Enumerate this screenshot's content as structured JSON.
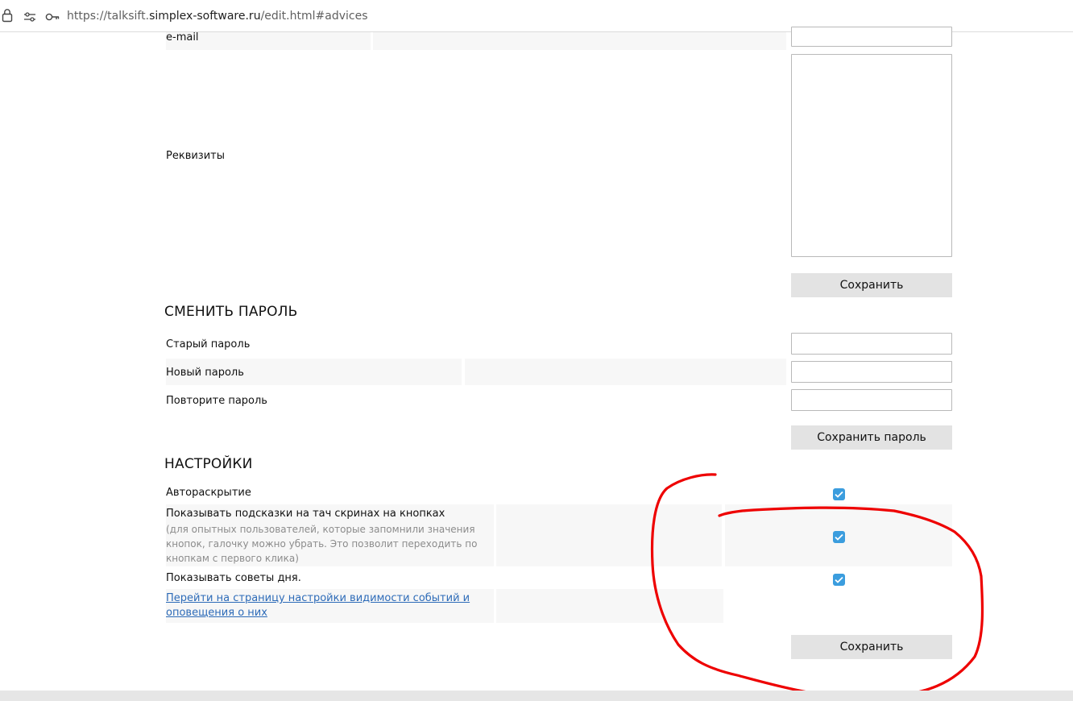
{
  "browser": {
    "url_prefix": "https://talksift.",
    "url_domain": "simplex-software.ru",
    "url_path": "/edit.html#advices"
  },
  "profile": {
    "email_label": "e-mail",
    "requisites_label": "Реквизиты",
    "save_label": "Сохранить"
  },
  "password": {
    "heading": "СМЕНИТЬ ПАРОЛЬ",
    "old_label": "Старый пароль",
    "new_label": "Новый пароль",
    "repeat_label": "Повторите пароль",
    "save_label": "Сохранить пароль"
  },
  "settings": {
    "heading": "НАСТРОЙКИ",
    "autoexpand_label": "Автораскрытие",
    "autoexpand_checked": true,
    "touch_hints_label": "Показывать подсказки на тач скринах на кнопках",
    "touch_hints_note": "(для опытных пользователей, которые запомнили значения кнопок, галочку можно убрать. Это позволит переходить по кнопкам с первого клика)",
    "touch_hints_checked": true,
    "tips_label": "Показывать советы дня.",
    "tips_checked": true,
    "events_link": "Перейти на страницу настройки видимости событий и оповещения о них",
    "save_label": "Сохранить"
  },
  "colors": {
    "accent_checkbox": "#3b9dde",
    "link": "#2d6bb8",
    "button_bg": "#e3e3e3",
    "annotation": "#ee0000"
  }
}
